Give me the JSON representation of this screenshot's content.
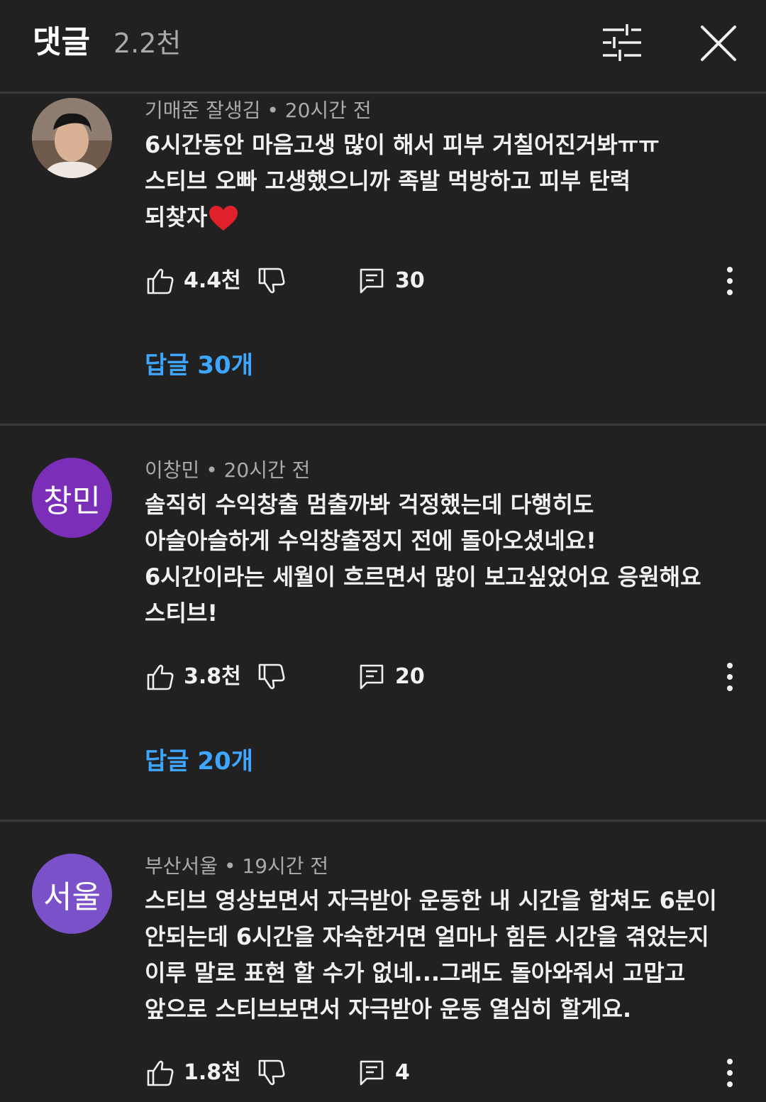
{
  "header": {
    "title": "댓글",
    "count": "2.2천"
  },
  "comments": [
    {
      "author": "기매준 잘생김",
      "time": "20시간 전",
      "avatar_text": "",
      "lines": [
        "6시간동안 마음고생 많이 해서 피부 거칠어진거봐ㅠㅠ",
        "스티브 오빠 고생했으니까 족발 먹방하고 피부 탄력",
        "되찾자"
      ],
      "likes": "4.4천",
      "reply_count": "30",
      "replies_label": "답글 30개"
    },
    {
      "author": "이창민",
      "time": "20시간 전",
      "avatar_text": "창민",
      "avatar_color": "#7b2eb8",
      "lines": [
        "솔직히 수익창출 멈출까봐 걱정했는데 다행히도",
        "아슬아슬하게 수익창출정지 전에 돌아오셨네요!",
        "6시간이라는 세월이 흐르면서 많이 보고싶었어요 응원해요",
        "스티브!"
      ],
      "likes": "3.8천",
      "reply_count": "20",
      "replies_label": "답글 20개"
    },
    {
      "author": "부산서울",
      "time": "19시간 전",
      "avatar_text": "서울",
      "avatar_color": "#7a51c9",
      "lines": [
        "스티브 영상보면서 자극받아 운동한 내 시간을 합쳐도 6분이",
        "안되는데 6시간을 자숙한거면 얼마나 힘든 시간을 겪었는지",
        "이루 말로 표현 할 수가 없네...그래도 돌아와줘서 고맙고",
        "앞으로 스티브보면서 자극받아 운동 열심히 할게요."
      ],
      "likes": "1.8천",
      "reply_count": "4"
    }
  ],
  "icons": {
    "filter": "sliders-icon",
    "close": "close-icon",
    "like": "thumb-up-icon",
    "dislike": "thumb-down-icon",
    "reply": "comment-icon",
    "more": "more-vertical-icon",
    "heart": "heart-emoji-icon"
  },
  "colors": {
    "background": "#212121",
    "link": "#3ea6ff",
    "secondary_text": "#aaaaaa"
  }
}
